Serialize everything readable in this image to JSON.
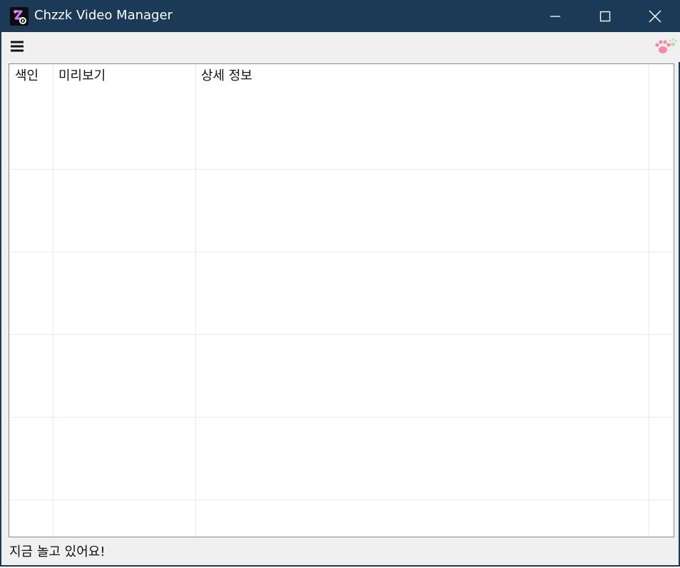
{
  "window": {
    "title": "Chzzk Video Manager",
    "titlebar_color": "#1a3a57",
    "icons": {
      "app": "chzzk-app-icon",
      "minimize": "minimize-icon",
      "maximize": "maximize-icon",
      "close": "close-icon"
    }
  },
  "toolbar": {
    "menu_icon": "hamburger-menu-icon",
    "paw_icon": "paw-icon"
  },
  "grid": {
    "columns": [
      {
        "label": "색인"
      },
      {
        "label": "미리보기"
      },
      {
        "label": "상세 정보"
      }
    ],
    "rows": [
      {},
      {},
      {},
      {},
      {},
      {}
    ]
  },
  "status": {
    "text": "지금 놀고 있어요!"
  }
}
